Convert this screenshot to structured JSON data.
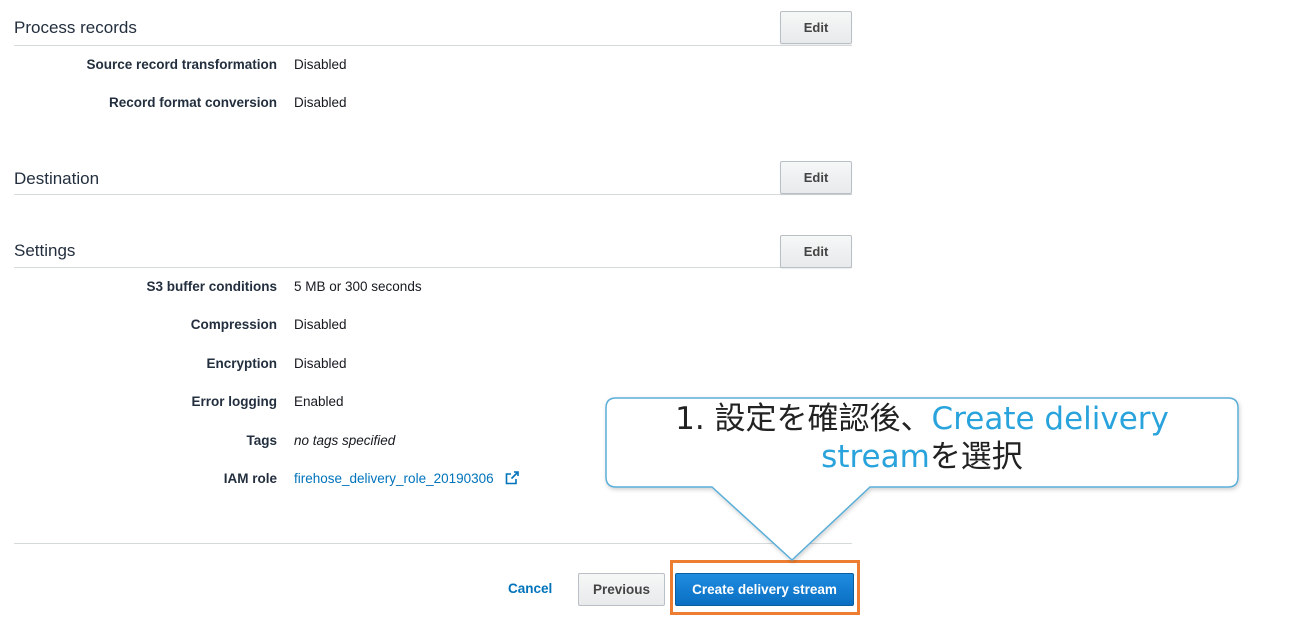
{
  "sections": {
    "process_records": {
      "title": "Process records",
      "edit_label": "Edit",
      "rows": [
        {
          "label": "Source record transformation",
          "value": "Disabled"
        },
        {
          "label": "Record format conversion",
          "value": "Disabled"
        }
      ]
    },
    "destination": {
      "title": "Destination",
      "edit_label": "Edit"
    },
    "settings": {
      "title": "Settings",
      "edit_label": "Edit",
      "rows": [
        {
          "label": "S3 buffer conditions",
          "value": "5 MB or 300 seconds"
        },
        {
          "label": "Compression",
          "value": "Disabled"
        },
        {
          "label": "Encryption",
          "value": "Disabled"
        },
        {
          "label": "Error logging",
          "value": "Enabled"
        },
        {
          "label": "Tags",
          "value": "no tags specified"
        },
        {
          "label": "IAM role",
          "value": "firehose_delivery_role_20190306"
        }
      ]
    }
  },
  "footer": {
    "cancel_label": "Cancel",
    "previous_label": "Previous",
    "create_label": "Create delivery stream"
  },
  "callout": {
    "line1_prefix": "1. 設定を確認後、",
    "highlight_line1": "Create delivery",
    "highlight_line2": "stream",
    "line2_suffix": "を選択"
  },
  "colors": {
    "primary_button": "#0a6fc2",
    "link": "#0073bb",
    "highlight_border": "#ed7d31",
    "callout_border": "#5aaed8",
    "callout_highlight_text": "#29a3dc"
  },
  "icons": {
    "iam_role_link": "external-link-icon"
  }
}
